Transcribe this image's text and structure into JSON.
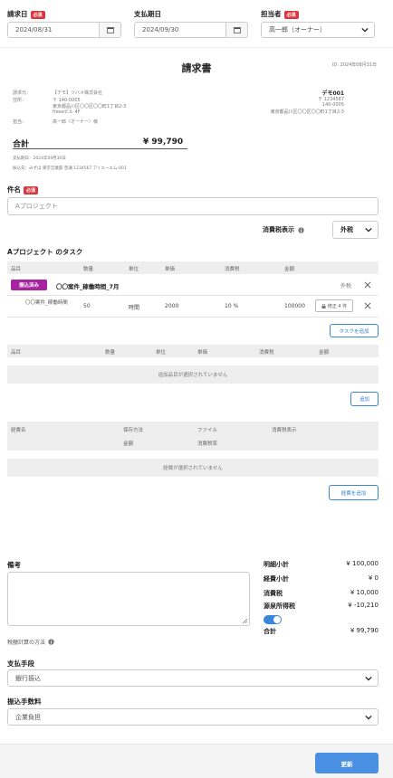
{
  "header": {
    "invoice_date_label": "請求日",
    "invoice_date_value": "2024/08/31",
    "due_date_label": "支払期日",
    "due_date_value": "2024/09/30",
    "assignee_label": "担当者",
    "assignee_value": "高一郎（オーナー）",
    "required_label": "必須"
  },
  "preview": {
    "id_text": "ID: 2024年08月31日",
    "title": "請求書",
    "to_label": "請求元：",
    "to_company": "【デモ】ツバメ株式会社",
    "addr_label": "住所：",
    "addr_lines": [
      "〒 140-0005",
      "東京都品川区〇〇区〇〇町1丁目2-3",
      "freeeビル 4F"
    ],
    "person_label": "担当：",
    "person_value": "高一郎（オーナー）様",
    "right_title": "デモ001",
    "right_lines": [
      "〒 1234567",
      "140-0005",
      "東京都品川区〇〇区〇〇町1丁目2-3"
    ],
    "total_label": "合計",
    "total_value": "¥ 99,790",
    "pay_due": "支払期日：2024年09月30日",
    "bank": "振込先：みずほ 東京営業部 普通 1234567 アイエーエム-001"
  },
  "subject": {
    "label": "件名",
    "value": "Aプロジェクト"
  },
  "tax_display": {
    "label": "消費税表示",
    "value": "外税"
  },
  "tasks": {
    "title": "Aプロジェクト のタスク",
    "headers": [
      "品目",
      "数量",
      "単位",
      "単価",
      "消費税",
      "金額"
    ],
    "group_badge": "振込済み",
    "group_name": "〇〇案件_稼働時間_7月",
    "group_tax": "外税",
    "row": {
      "name": "〇〇案件_稼働時間",
      "qty": "50",
      "unit": "時間",
      "price": "2000",
      "tax": "10 %",
      "amount": "100000",
      "edit": "修正 4 件"
    },
    "add_task_button": "タスクを追加"
  },
  "items": {
    "headers": [
      "品目",
      "数量",
      "単位",
      "単価",
      "消費税",
      "金額"
    ],
    "empty": "追加品目が選択されていません",
    "add_button": "追加"
  },
  "expenses": {
    "headers_top": [
      "経費名",
      "保存方法",
      "ファイル",
      "消費税表示"
    ],
    "headers_bottom": [
      "金額",
      "消費税率"
    ],
    "empty": "経費が選択されていません",
    "add_button": "経費を追加"
  },
  "notes": {
    "label": "備考",
    "calc_label": "税額計算の方法"
  },
  "summary": {
    "rows": [
      {
        "label": "明細小計",
        "value": "¥ 100,000"
      },
      {
        "label": "経費小計",
        "value": "¥ 0"
      },
      {
        "label": "消費税",
        "value": "¥ 10,000"
      },
      {
        "label": "源泉所得税",
        "value": "¥ -10,210"
      }
    ],
    "total_label": "合計",
    "total_value": "¥ 99,790"
  },
  "payment_method": {
    "label": "支払手段",
    "value": "銀行振込"
  },
  "transfer_fee": {
    "label": "振込手数料",
    "value": "企業負担"
  },
  "footer": {
    "update_button": "更新"
  },
  "colors": {
    "accent": "#3a86d9",
    "required": "#d9363e",
    "badge": "#a8239f",
    "toggle": "#3a86d9"
  }
}
